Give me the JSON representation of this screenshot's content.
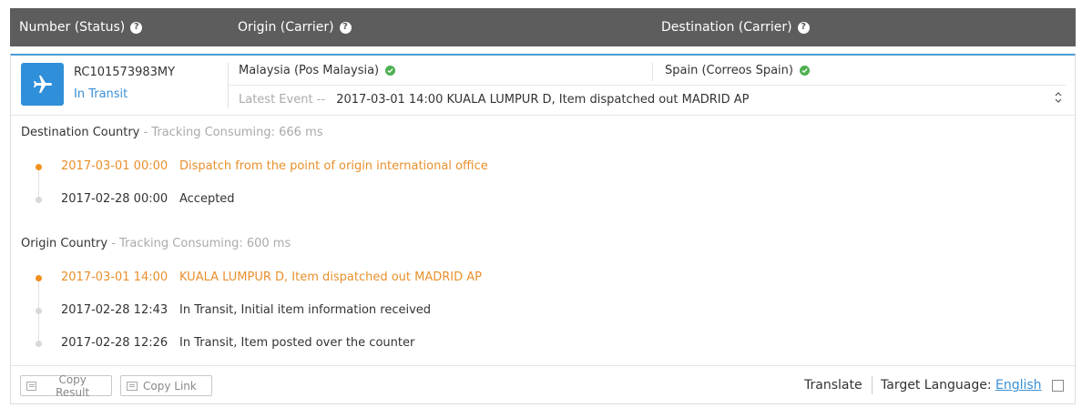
{
  "header": {
    "col_number": "Number (Status)",
    "col_origin": "Origin (Carrier)",
    "col_destination": "Destination (Carrier)"
  },
  "shipment": {
    "tracking_number": "RC101573983MY",
    "status": "In Transit",
    "origin_carrier": "Malaysia (Pos Malaysia)",
    "destination_carrier": "Spain (Correos Spain)",
    "latest_event_label": "Latest Event --",
    "latest_event_text": "2017-03-01 14:00 KUALA LUMPUR D, Item dispatched out MADRID AP"
  },
  "destination_section": {
    "title": "Destination Country",
    "meta": " - Tracking Consuming: 666 ms",
    "events": [
      {
        "time": "2017-03-01 00:00",
        "desc": "Dispatch from the point of origin international office"
      },
      {
        "time": "2017-02-28 00:00",
        "desc": "Accepted"
      }
    ]
  },
  "origin_section": {
    "title": "Origin Country",
    "meta": " - Tracking Consuming: 600 ms",
    "events": [
      {
        "time": "2017-03-01 14:00",
        "desc": "KUALA LUMPUR D, Item dispatched out MADRID AP"
      },
      {
        "time": "2017-02-28 12:43",
        "desc": "In Transit, Initial item information received"
      },
      {
        "time": "2017-02-28 12:26",
        "desc": "In Transit, Item posted over the counter"
      }
    ]
  },
  "footer": {
    "copy_result": "Copy Result",
    "copy_link": "Copy Link",
    "translate": "Translate",
    "target_language_label": "Target Language:",
    "target_language_value": "English"
  },
  "colors": {
    "header_bg": "#5d5d5d",
    "accent_blue": "#2f8fd8",
    "active_orange": "#e8902c",
    "check_green": "#4caf50"
  },
  "icons": {
    "help": "help-icon",
    "plane": "airplane-icon",
    "check": "check-circle-icon",
    "expand": "chevron-updown-icon"
  }
}
